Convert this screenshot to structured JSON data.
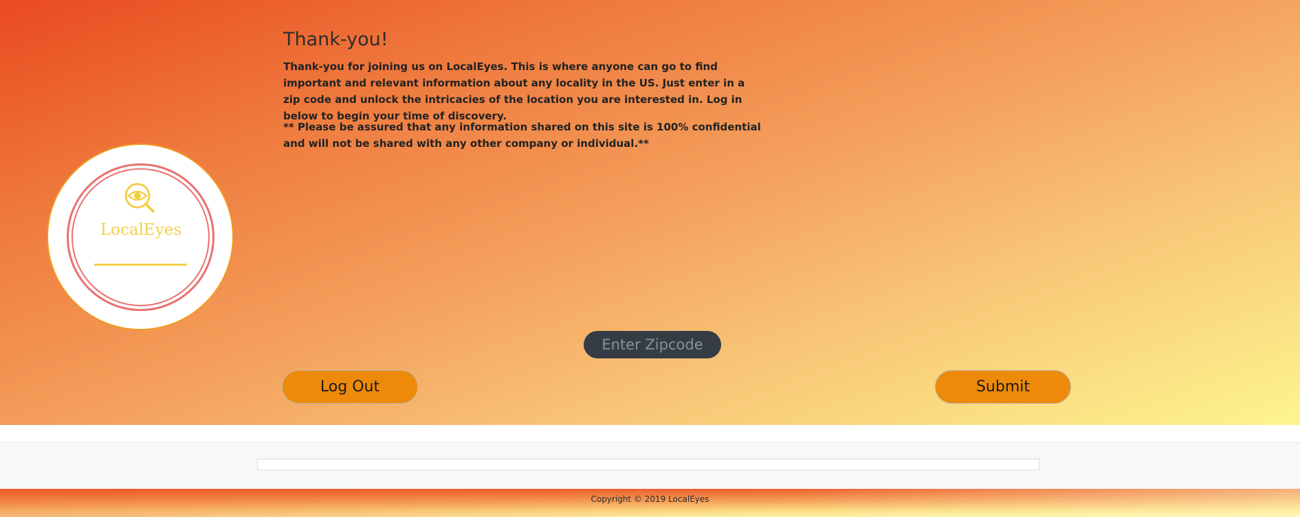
{
  "intro": {
    "title": "Thank-you!",
    "paragraph1": "Thank-you for joining us on LocalEyes. This is where anyone can go to find important and relevant information about any locality in the US. Just enter in a zip code and unlock the intricacies of the location you are interested in. Log in below to begin your time of discovery.",
    "paragraph2": "** Please be assured that any information shared on this site is 100% confidential and will not be shared with any other company or individual.**"
  },
  "logo": {
    "text": "LocalEyes",
    "icon": "eye-magnifier-icon",
    "color": "#f3cf48",
    "ring_color": "#e9706f"
  },
  "form": {
    "zip_placeholder": "Enter Zipcode",
    "zip_value": "",
    "logout_label": "Log Out",
    "submit_label": "Submit"
  },
  "footer": {
    "copyright": "Copyright © 2019 LocalEyes"
  },
  "colors": {
    "button": "#ee8a0a",
    "input_bg": "#353c46",
    "gradient_start": "#e94a1f",
    "gradient_end": "#fdf58e"
  }
}
